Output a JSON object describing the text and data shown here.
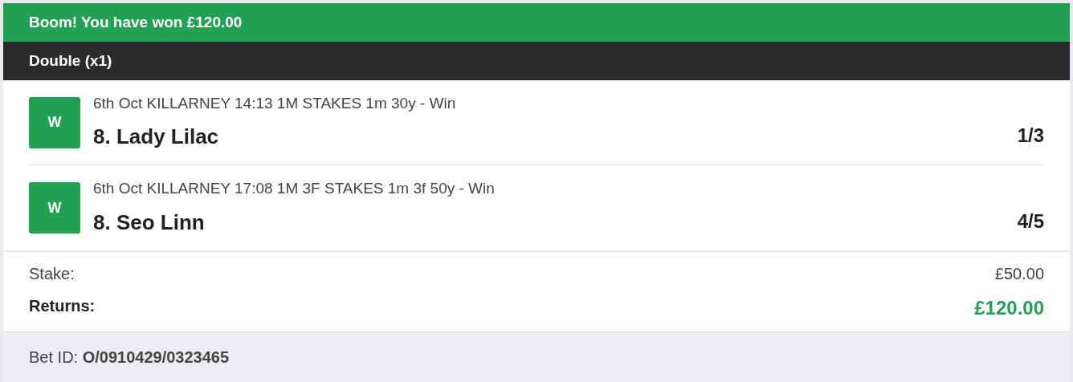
{
  "banner": "Boom! You have won £120.00",
  "bet_type": "Double (x1)",
  "legs": [
    {
      "result": "W",
      "event": "6th Oct KILLARNEY 14:13 1M STAKES 1m 30y - Win",
      "selection": "8. Lady Lilac",
      "odds": "1/3"
    },
    {
      "result": "W",
      "event": "6th Oct KILLARNEY 17:08 1M 3F STAKES 1m 3f 50y - Win",
      "selection": "8. Seo Linn",
      "odds": "4/5"
    }
  ],
  "stake": {
    "label": "Stake:",
    "value": "£50.00"
  },
  "returns": {
    "label": "Returns:",
    "value": "£120.00"
  },
  "bet_id": "Bet ID: **O/0910429/0323465**"
}
